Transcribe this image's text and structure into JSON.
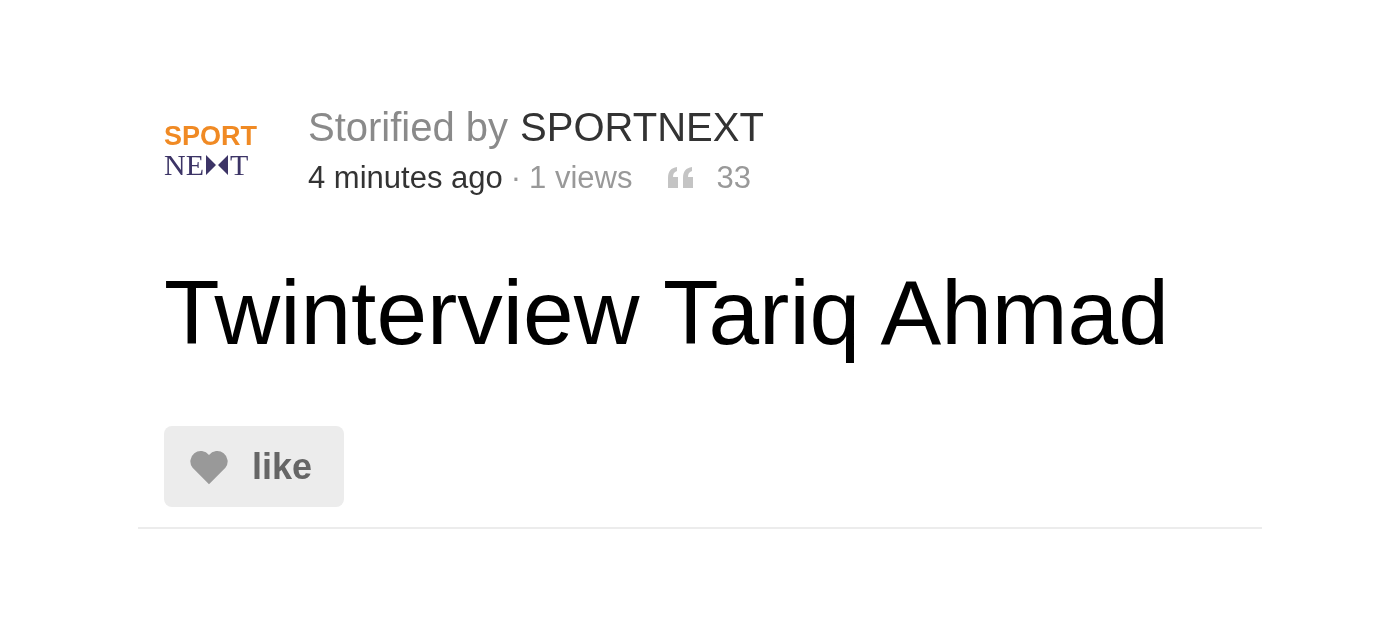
{
  "logo": {
    "top": "SPORT",
    "bottom_left": "NE",
    "bottom_right": "T"
  },
  "byline": {
    "prefix": "Storified by",
    "author": "SPORTNEXT"
  },
  "meta": {
    "time": "4 minutes ago",
    "separator": "·",
    "views": "1 views",
    "quotes": "33"
  },
  "title": "Twinterview Tariq Ahmad",
  "like_button": {
    "label": "like"
  }
}
